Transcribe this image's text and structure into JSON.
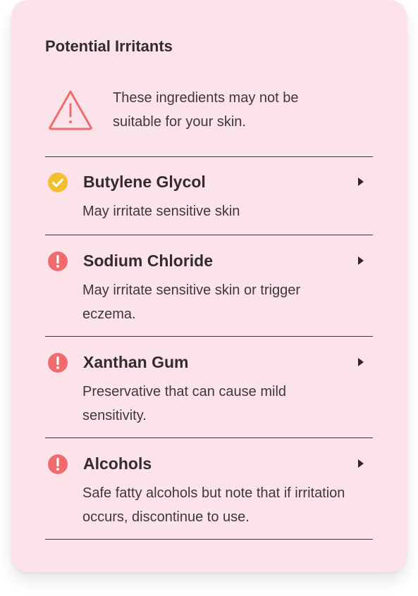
{
  "card": {
    "title": "Potential Irritants",
    "warning_text": "These ingredients may not be suitable for your skin.",
    "warning_icon": "warning-triangle-icon"
  },
  "colors": {
    "background": "#fce3ea",
    "warning_red": "#ee6c6e",
    "check_yellow": "#f4bf2f",
    "divider": "#3b3335"
  },
  "items": [
    {
      "name": "Butylene Glycol",
      "description": "May irritate sensitive skin",
      "status": "ok",
      "icon": "check-circle-icon"
    },
    {
      "name": "Sodium Chloride",
      "description": "May irritate sensitive skin or trigger eczema.",
      "status": "alert",
      "icon": "alert-circle-icon"
    },
    {
      "name": "Xanthan Gum",
      "description": "Preservative that can cause mild sensitivity.",
      "status": "alert",
      "icon": "alert-circle-icon"
    },
    {
      "name": "Alcohols",
      "description": "Safe fatty alcohols but note that if irritation occurs, discontinue to use.",
      "status": "alert",
      "icon": "alert-circle-icon"
    }
  ]
}
